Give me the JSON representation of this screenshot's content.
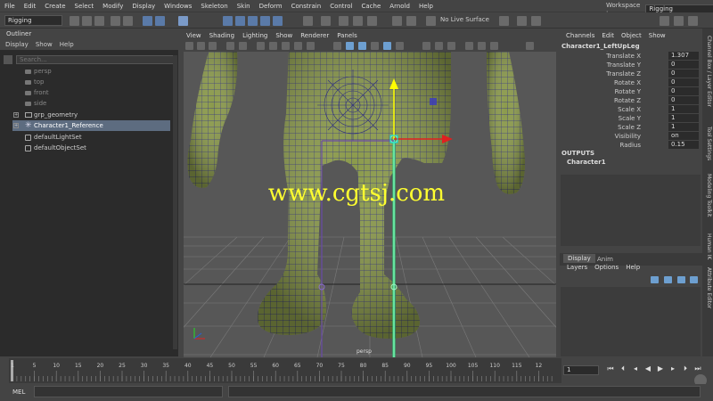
{
  "menubar": {
    "items": [
      "File",
      "Edit",
      "Create",
      "Select",
      "Modify",
      "Display",
      "Windows",
      "Skeleton",
      "Skin",
      "Deform",
      "Constrain",
      "Control",
      "Cache",
      "Arnold",
      "Help"
    ]
  },
  "workspace": {
    "label": "Workspace :",
    "value": "Rigging"
  },
  "shelf": {
    "mode": "Rigging",
    "live_surface": "No Live Surface"
  },
  "outliner": {
    "title": "Outliner",
    "menu": [
      "Display",
      "Show",
      "Help"
    ],
    "search_placeholder": "Search...",
    "items": [
      {
        "label": "persp"
      },
      {
        "label": "top"
      },
      {
        "label": "front"
      },
      {
        "label": "side"
      },
      {
        "label": "grp_geometry"
      },
      {
        "label": "Character1_Reference"
      },
      {
        "label": "defaultLightSet"
      },
      {
        "label": "defaultObjectSet"
      }
    ]
  },
  "viewport": {
    "menu": [
      "View",
      "Shading",
      "Lighting",
      "Show",
      "Renderer",
      "Panels"
    ],
    "camera_label": "persp"
  },
  "channels": {
    "menu": [
      "Channels",
      "Edit",
      "Object",
      "Show"
    ],
    "node": "Character1_LeftUpLeg",
    "attrs": [
      {
        "label": "Translate X",
        "value": "1.307"
      },
      {
        "label": "Translate Y",
        "value": "0"
      },
      {
        "label": "Translate Z",
        "value": "0"
      },
      {
        "label": "Rotate X",
        "value": "0"
      },
      {
        "label": "Rotate Y",
        "value": "0"
      },
      {
        "label": "Rotate Z",
        "value": "0"
      },
      {
        "label": "Scale X",
        "value": "1"
      },
      {
        "label": "Scale Y",
        "value": "1"
      },
      {
        "label": "Scale Z",
        "value": "1"
      },
      {
        "label": "Visibility",
        "value": "on"
      },
      {
        "label": "Radius",
        "value": "0.15"
      }
    ],
    "outputs_label": "OUTPUTS",
    "outputs_item": "Character1"
  },
  "layers": {
    "tabs": [
      "Display",
      "Anim"
    ],
    "menu": [
      "Layers",
      "Options",
      "Help"
    ]
  },
  "side_tabs": [
    "Channel Box / Layer Editor",
    "Tool Settings",
    "Modeling Toolkit",
    "Human IK",
    "Attribute Editor"
  ],
  "timeline": {
    "ticks": [
      "1",
      "5",
      "10",
      "15",
      "20",
      "25",
      "30",
      "35",
      "40",
      "45",
      "50",
      "55",
      "60",
      "65",
      "70",
      "75",
      "80",
      "85",
      "90",
      "95",
      "100",
      "105",
      "110",
      "115",
      "12"
    ],
    "current_frame": "1"
  },
  "command": {
    "label": "MEL"
  },
  "watermark": "www.cgtsj.com",
  "colors": {
    "panel": "#444444",
    "dark": "#2b2b2b",
    "selected": "#5d6c80",
    "mesh": "#8a9a4a",
    "wire": "#2a2a8a",
    "joint": "#2fd27a",
    "gizmo_y": "#ffff00",
    "gizmo_x": "#e02020"
  }
}
